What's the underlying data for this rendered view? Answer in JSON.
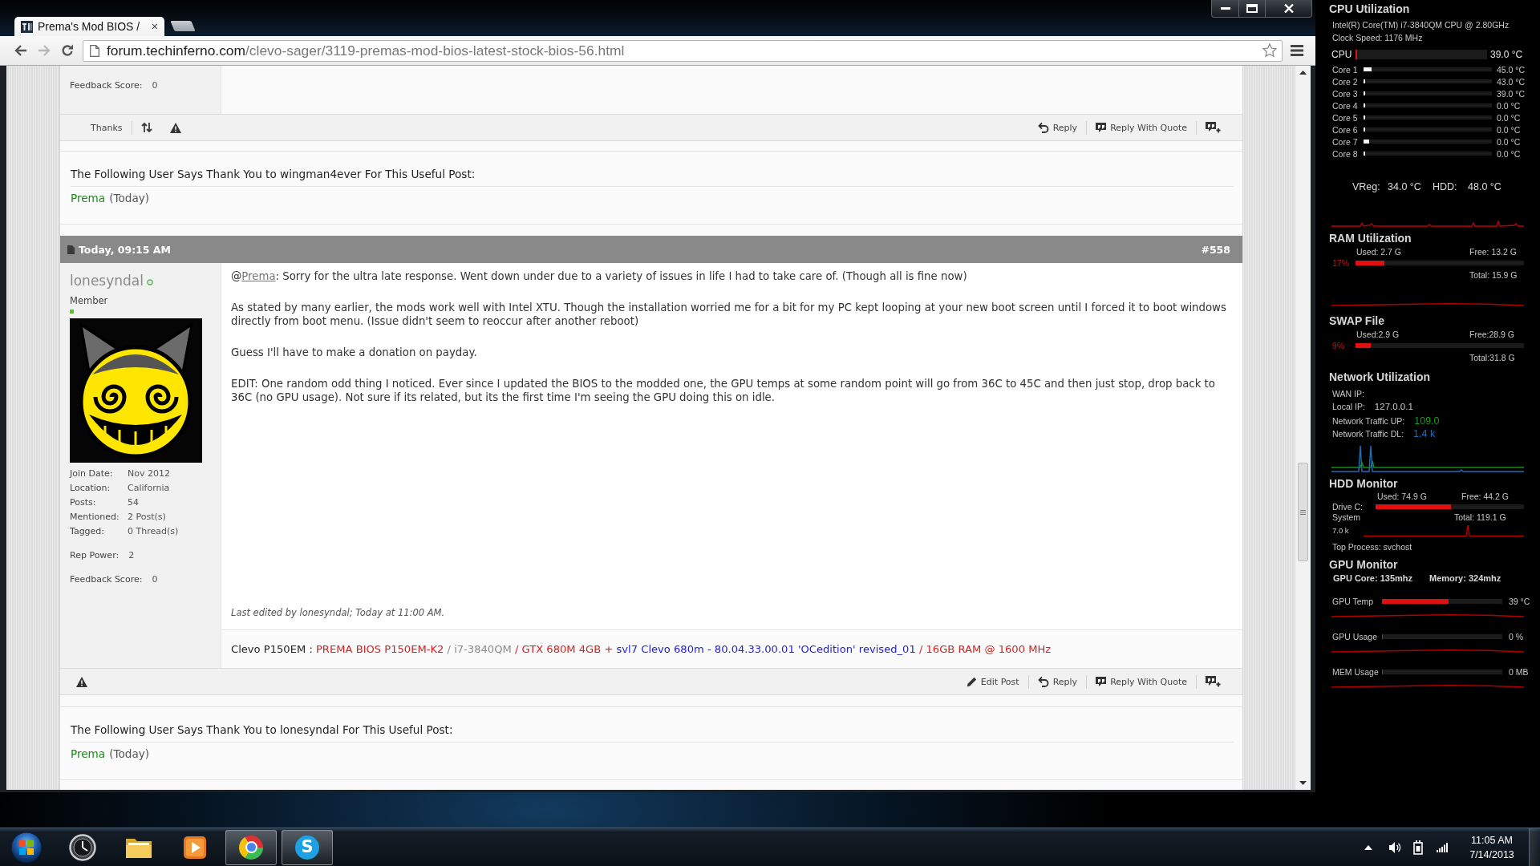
{
  "browser": {
    "tabs": [
      {
        "title": "Prema's Mod BIOS /",
        "close": "×",
        "selected": true
      }
    ],
    "address": {
      "host": "forum.techinferno.com",
      "path": "/clevo-sager/3119-premas-mod-bios-latest-stock-bios-56.html"
    }
  },
  "previous_post": {
    "user_fields": [
      {
        "label": "Feedback Score:",
        "value": "0"
      }
    ],
    "left_actions": [
      {
        "kind": "thanks",
        "label": "Thanks"
      },
      {
        "kind": "swap"
      },
      {
        "kind": "report"
      }
    ],
    "right_actions": [
      {
        "kind": "reply",
        "label": "Reply"
      },
      {
        "kind": "quote",
        "label": "Reply With Quote"
      },
      {
        "kind": "multiquote"
      }
    ]
  },
  "thanks_1": {
    "heading": "The Following User Says Thank You to wingman4ever For This Useful Post:",
    "users": [
      {
        "name": "Prema",
        "when": "(Today)"
      }
    ]
  },
  "post": {
    "date": "Today, 09:15 AM",
    "number": "#558",
    "username": "lonesyndal",
    "online": true,
    "rank": "Member",
    "details": [
      {
        "label": "Join Date:",
        "value": "Nov 2012"
      },
      {
        "label": "Location:",
        "value": "California"
      },
      {
        "label": "Posts:",
        "value": "54"
      },
      {
        "label": "Mentioned:",
        "value": "2 Post(s)"
      },
      {
        "label": "Tagged:",
        "value": "0 Thread(s)"
      }
    ],
    "extras": [
      {
        "label": "Rep Power:",
        "value": "2"
      },
      {
        "label": "Feedback Score:",
        "value": "0"
      }
    ],
    "paragraphs": [
      {
        "prefix": "@",
        "mention": "Prema",
        "text": ": Sorry for the ultra late response. Went down under due to a variety of issues in life I had to take care of. (Though all is fine now)"
      },
      {
        "text": "As stated by many earlier, the mods work well with Intel XTU. Though the installation worried me for a bit for my PC kept looping at your new boot screen until I forced it to boot windows directly from boot menu. (Issue didn't seem to reoccur after another reboot)"
      },
      {
        "text": "Guess I'll have to make a donation on payday."
      },
      {
        "text": "EDIT: One random odd thing I noticed. Ever since I updated the BIOS to the modded one, the GPU temps at some random point will go from 36C to 45C and then just stop, drop back to 36C (no GPU usage). Not sure if its related, but its the first time I'm seeing the GPU doing this on idle."
      }
    ],
    "edit_note": "Last edited by lonesyndal; Today at 11:00 AM.",
    "signature": [
      {
        "text": "Clevo P150EM :",
        "color": "#222222"
      },
      {
        "text": "PREMA BIOS P150EM-K2",
        "color": "#d42020"
      },
      {
        "text": "/ i7-3840QM",
        "color": "#8a8a8a"
      },
      {
        "text": "/ GTX 680M 4GB +",
        "color": "#d42020"
      },
      {
        "text": "svl7 Clevo 680m - 80.04.33.00.01 'OCedition' revised_01",
        "color": "#2222cc"
      },
      {
        "text": "/ 16GB RAM @ 1600 MHz",
        "color": "#d42020"
      }
    ],
    "left_actions": [
      {
        "kind": "report"
      }
    ],
    "right_actions": [
      {
        "kind": "edit",
        "label": "Edit Post"
      },
      {
        "kind": "reply",
        "label": "Reply"
      },
      {
        "kind": "quote",
        "label": "Reply With Quote"
      },
      {
        "kind": "multiquote"
      }
    ]
  },
  "thanks_2": {
    "heading": "The Following User Says Thank You to lonesyndal For This Useful Post:",
    "users": [
      {
        "name": "Prema",
        "when": "(Today)"
      }
    ]
  },
  "gadgets": {
    "cpu": {
      "title": "CPU Utilization",
      "model": "Intel(R) Core(TM) i7-3840QM CPU @ 2.80GHz",
      "clock": "Clock Speed: 1176 MHz",
      "total": {
        "label": "CPU",
        "level": 0.01,
        "reading": "39.0 °C"
      },
      "cores": [
        {
          "label": "Core 1",
          "level": 0.06,
          "reading": "45.0 °C"
        },
        {
          "label": "Core 2",
          "level": 0.015,
          "reading": "43.0 °C"
        },
        {
          "label": "Core 3",
          "level": 0.015,
          "reading": "39.0 °C"
        },
        {
          "label": "Core 4",
          "level": 0.015,
          "reading": "0.0 °C"
        },
        {
          "label": "Core 5",
          "level": 0.015,
          "reading": "0.0 °C"
        },
        {
          "label": "Core 6",
          "level": 0.015,
          "reading": "0.0 °C"
        },
        {
          "label": "Core 7",
          "level": 0.045,
          "reading": "0.0 °C"
        },
        {
          "label": "Core 8",
          "level": 0.015,
          "reading": "0.0 °C"
        }
      ],
      "sensors": [
        {
          "label": "VReg:",
          "reading": "34.0 °C"
        },
        {
          "label": "HDD:",
          "reading": "48.0 °C"
        }
      ]
    },
    "ram": {
      "title": "RAM Utilization",
      "used": "Used: 2.7 G",
      "free": "Free: 13.2 G",
      "percent": "17%",
      "level": 0.17,
      "total": "Total: 15.9 G"
    },
    "swap": {
      "title": "SWAP File",
      "used": "Used:2.9 G",
      "free": "Free:28.9 G",
      "percent": "9%",
      "level": 0.09,
      "total": "Total:31.8 G"
    },
    "network": {
      "title": "Network Utilization",
      "rows": [
        {
          "label": "WAN IP:"
        },
        {
          "label": "Local IP:",
          "value": "127.0.0.1"
        },
        {
          "label": "Network Traffic UP:",
          "value": "109.0",
          "color": "#1e9a1e"
        },
        {
          "label": "Network Traffic DL:",
          "value": "1.4 k",
          "color": "#1f6fb8"
        }
      ]
    },
    "hdd": {
      "title": "HDD Monitor",
      "used": "Used: 74.9 G",
      "free": "Free: 44.2 G",
      "drive": "Drive C:",
      "volume": "System",
      "level": 0.51,
      "total": "Total: 119.1 G",
      "rate": "7.0 k",
      "top_process": "Top Process: svchost"
    },
    "gpu": {
      "title": "GPU Monitor",
      "clocks": [
        "GPU Core: 135mhz",
        "Memory: 324mhz"
      ],
      "meters": [
        {
          "label": "GPU Temp",
          "level": 0.55,
          "reading": "39 °C"
        },
        {
          "label": "GPU Usage",
          "level": 0,
          "reading": "0 %"
        },
        {
          "label": "MEM Usage",
          "level": 0,
          "reading": "0 MB"
        }
      ]
    }
  },
  "taskbar": {
    "apps": [
      {
        "kind": "clock",
        "running": false
      },
      {
        "kind": "folder",
        "running": false
      },
      {
        "kind": "media",
        "running": false
      },
      {
        "kind": "chrome",
        "running": true
      },
      {
        "kind": "skype",
        "running": true,
        "glyph": "S"
      }
    ],
    "time": "11:05 AM",
    "date": "7/14/2013"
  }
}
